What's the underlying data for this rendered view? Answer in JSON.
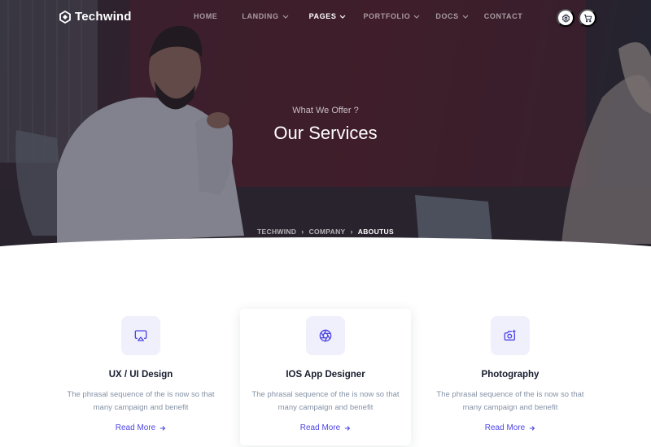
{
  "brand": {
    "name": "Techwind",
    "logo_icon": "logo-icon"
  },
  "nav": {
    "items": [
      {
        "label": "HOME",
        "has_dropdown": false,
        "active": false
      },
      {
        "label": "LANDING",
        "has_dropdown": true,
        "active": false
      },
      {
        "label": "PAGES",
        "has_dropdown": true,
        "active": true
      },
      {
        "label": "PORTFOLIO",
        "has_dropdown": true,
        "active": false
      },
      {
        "label": "DOCS",
        "has_dropdown": true,
        "active": false
      },
      {
        "label": "CONTACT",
        "has_dropdown": false,
        "active": false
      }
    ],
    "actions": [
      {
        "icon": "gear-icon"
      },
      {
        "icon": "cart-icon"
      }
    ]
  },
  "hero": {
    "subtitle": "What We Offer ?",
    "title": "Our Services",
    "breadcrumb": [
      "TECHWIND",
      "COMPANY",
      "ABOUTUS"
    ]
  },
  "services": [
    {
      "icon": "airplay-icon",
      "title": "UX / UI Design",
      "description": "The phrasal sequence of the is now so that many campaign and benefit",
      "link": "Read More",
      "featured": false
    },
    {
      "icon": "aperture-icon",
      "title": "IOS App Designer",
      "description": "The phrasal sequence of the is now so that many campaign and benefit",
      "link": "Read More",
      "featured": true
    },
    {
      "icon": "camera-icon",
      "title": "Photography",
      "description": "The phrasal sequence of the is now so that many campaign and benefit",
      "link": "Read More",
      "featured": false
    }
  ],
  "colors": {
    "accent": "#4f46e5",
    "icon_bg": "#eff0fb",
    "muted_text": "#8492a6",
    "dark_text": "#161c2d",
    "hero_overlay": "#161c2d"
  }
}
